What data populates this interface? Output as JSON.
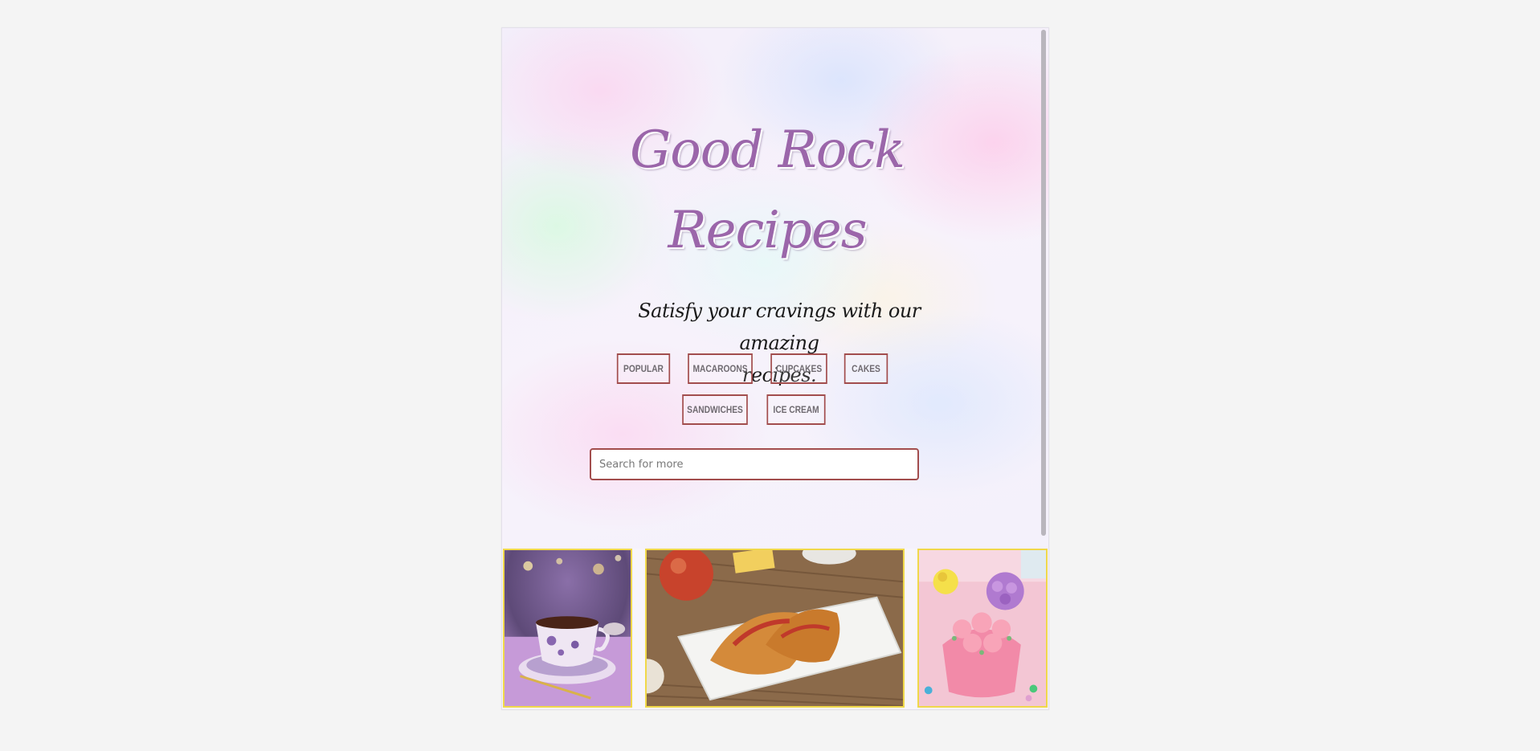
{
  "site": {
    "title_line1": "Good Rock",
    "title_line2": "Recipes",
    "subtitle_line1": "Satisfy your cravings with our amazing",
    "subtitle_line2": "recipes."
  },
  "categories": [
    {
      "label": "POPULAR"
    },
    {
      "label": "MACAROONS"
    },
    {
      "label": "CUPCAKES"
    },
    {
      "label": "CAKES"
    },
    {
      "label": "SANDWICHES"
    },
    {
      "label": "ICE CREAM"
    }
  ],
  "search": {
    "placeholder": "Search for more",
    "value": ""
  },
  "gallery": [
    {
      "icon": "tea-cup-photo"
    },
    {
      "icon": "pastry-plate-photo"
    },
    {
      "icon": "cupcakes-photo"
    }
  ],
  "colors": {
    "title": "#9b66aa",
    "button_border": "#a24d4d",
    "thumb_border": "#f0d84a",
    "page_bg": "#f4f4f4"
  }
}
